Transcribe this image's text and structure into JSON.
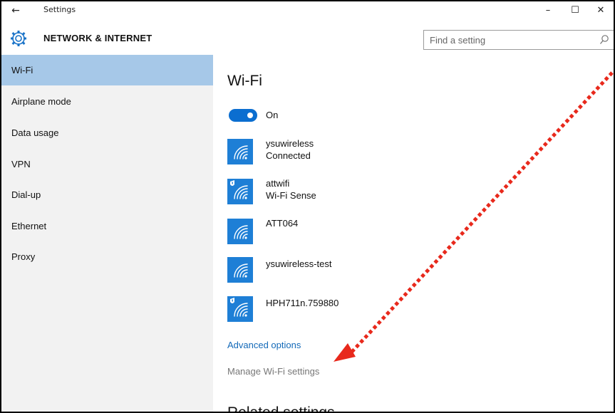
{
  "window": {
    "title": "Settings",
    "back_icon": "back-arrow-icon",
    "controls": {
      "minimize": "–",
      "maximize": "☐",
      "close": "✕"
    }
  },
  "header": {
    "icon": "gear-icon",
    "title": "NETWORK & INTERNET",
    "search_placeholder": "Find a setting"
  },
  "sidebar": {
    "items": [
      {
        "label": "Wi-Fi",
        "active": true
      },
      {
        "label": "Airplane mode"
      },
      {
        "label": "Data usage"
      },
      {
        "label": "VPN"
      },
      {
        "label": "Dial-up"
      },
      {
        "label": "Ethernet"
      },
      {
        "label": "Proxy"
      }
    ]
  },
  "main": {
    "title": "Wi-Fi",
    "toggle": {
      "state": "On",
      "enabled": true
    },
    "networks": [
      {
        "name": "ysuwireless",
        "status": "Connected",
        "secured": false,
        "icon": "wifi-icon"
      },
      {
        "name": "attwifi",
        "status": "Wi-Fi Sense",
        "secured": true,
        "icon": "wifi-shield-icon"
      },
      {
        "name": "ATT064",
        "status": "",
        "secured": false,
        "icon": "wifi-icon"
      },
      {
        "name": "ysuwireless-test",
        "status": "",
        "secured": false,
        "icon": "wifi-icon"
      },
      {
        "name": "HPH711n.759880",
        "status": "",
        "secured": true,
        "icon": "wifi-shield-icon"
      }
    ],
    "advanced_link": "Advanced options",
    "manage_link": "Manage Wi-Fi settings",
    "related_heading": "Related settings"
  },
  "colors": {
    "accent": "#1e7fd6",
    "active_nav": "#a6c8e8",
    "sidebar_bg": "#f2f2f2",
    "link": "#1369b8",
    "annotation_arrow": "#e8291c"
  }
}
